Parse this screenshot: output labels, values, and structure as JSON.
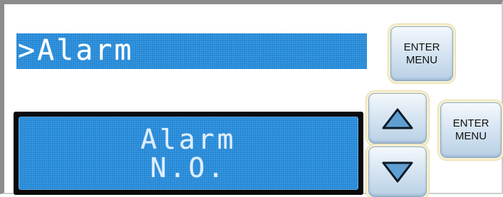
{
  "top_display": {
    "text": ">Alarm"
  },
  "bottom_display": {
    "line1": "Alarm",
    "line2": "N.O."
  },
  "buttons": {
    "enter_top": {
      "line1": "ENTER",
      "line2": "MENU"
    },
    "enter_bottom": {
      "line1": "ENTER",
      "line2": "MENU"
    },
    "up_icon": "up-triangle-icon",
    "down_icon": "down-triangle-icon"
  },
  "colors": {
    "lcd_blue": "#1f86d6",
    "lcd_text": "#ffffff",
    "bezel": "#0a0a0a",
    "key_face": "#d8e6f2",
    "key_glow": "#f6efcf"
  }
}
